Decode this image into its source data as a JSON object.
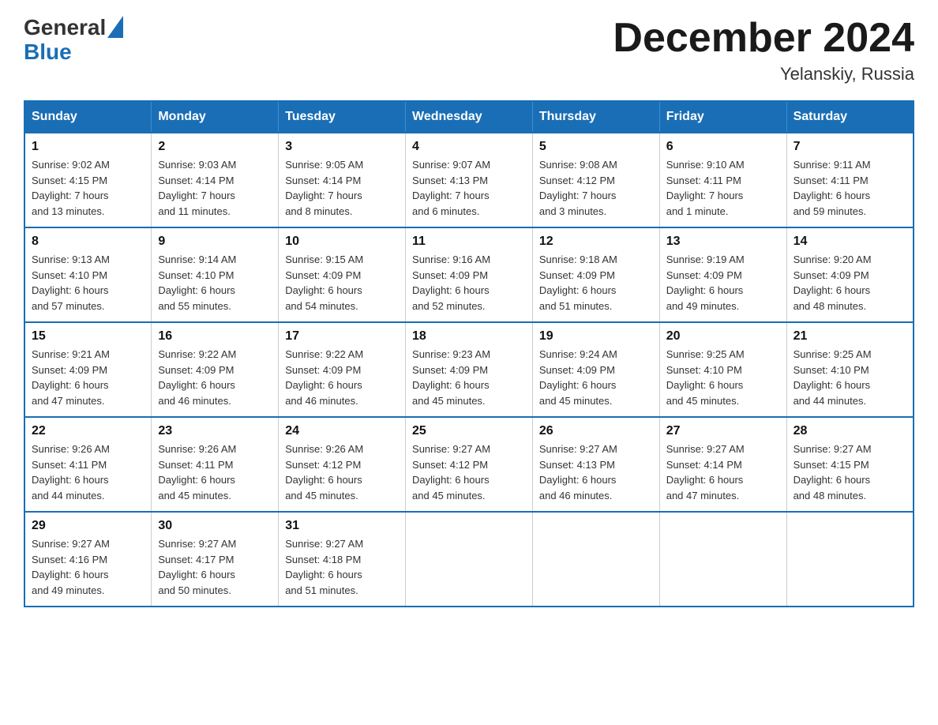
{
  "header": {
    "logo_general": "General",
    "logo_blue": "Blue",
    "month_title": "December 2024",
    "location": "Yelanskiy, Russia"
  },
  "days_of_week": [
    "Sunday",
    "Monday",
    "Tuesday",
    "Wednesday",
    "Thursday",
    "Friday",
    "Saturday"
  ],
  "weeks": [
    [
      {
        "day": "1",
        "info": "Sunrise: 9:02 AM\nSunset: 4:15 PM\nDaylight: 7 hours\nand 13 minutes."
      },
      {
        "day": "2",
        "info": "Sunrise: 9:03 AM\nSunset: 4:14 PM\nDaylight: 7 hours\nand 11 minutes."
      },
      {
        "day": "3",
        "info": "Sunrise: 9:05 AM\nSunset: 4:14 PM\nDaylight: 7 hours\nand 8 minutes."
      },
      {
        "day": "4",
        "info": "Sunrise: 9:07 AM\nSunset: 4:13 PM\nDaylight: 7 hours\nand 6 minutes."
      },
      {
        "day": "5",
        "info": "Sunrise: 9:08 AM\nSunset: 4:12 PM\nDaylight: 7 hours\nand 3 minutes."
      },
      {
        "day": "6",
        "info": "Sunrise: 9:10 AM\nSunset: 4:11 PM\nDaylight: 7 hours\nand 1 minute."
      },
      {
        "day": "7",
        "info": "Sunrise: 9:11 AM\nSunset: 4:11 PM\nDaylight: 6 hours\nand 59 minutes."
      }
    ],
    [
      {
        "day": "8",
        "info": "Sunrise: 9:13 AM\nSunset: 4:10 PM\nDaylight: 6 hours\nand 57 minutes."
      },
      {
        "day": "9",
        "info": "Sunrise: 9:14 AM\nSunset: 4:10 PM\nDaylight: 6 hours\nand 55 minutes."
      },
      {
        "day": "10",
        "info": "Sunrise: 9:15 AM\nSunset: 4:09 PM\nDaylight: 6 hours\nand 54 minutes."
      },
      {
        "day": "11",
        "info": "Sunrise: 9:16 AM\nSunset: 4:09 PM\nDaylight: 6 hours\nand 52 minutes."
      },
      {
        "day": "12",
        "info": "Sunrise: 9:18 AM\nSunset: 4:09 PM\nDaylight: 6 hours\nand 51 minutes."
      },
      {
        "day": "13",
        "info": "Sunrise: 9:19 AM\nSunset: 4:09 PM\nDaylight: 6 hours\nand 49 minutes."
      },
      {
        "day": "14",
        "info": "Sunrise: 9:20 AM\nSunset: 4:09 PM\nDaylight: 6 hours\nand 48 minutes."
      }
    ],
    [
      {
        "day": "15",
        "info": "Sunrise: 9:21 AM\nSunset: 4:09 PM\nDaylight: 6 hours\nand 47 minutes."
      },
      {
        "day": "16",
        "info": "Sunrise: 9:22 AM\nSunset: 4:09 PM\nDaylight: 6 hours\nand 46 minutes."
      },
      {
        "day": "17",
        "info": "Sunrise: 9:22 AM\nSunset: 4:09 PM\nDaylight: 6 hours\nand 46 minutes."
      },
      {
        "day": "18",
        "info": "Sunrise: 9:23 AM\nSunset: 4:09 PM\nDaylight: 6 hours\nand 45 minutes."
      },
      {
        "day": "19",
        "info": "Sunrise: 9:24 AM\nSunset: 4:09 PM\nDaylight: 6 hours\nand 45 minutes."
      },
      {
        "day": "20",
        "info": "Sunrise: 9:25 AM\nSunset: 4:10 PM\nDaylight: 6 hours\nand 45 minutes."
      },
      {
        "day": "21",
        "info": "Sunrise: 9:25 AM\nSunset: 4:10 PM\nDaylight: 6 hours\nand 44 minutes."
      }
    ],
    [
      {
        "day": "22",
        "info": "Sunrise: 9:26 AM\nSunset: 4:11 PM\nDaylight: 6 hours\nand 44 minutes."
      },
      {
        "day": "23",
        "info": "Sunrise: 9:26 AM\nSunset: 4:11 PM\nDaylight: 6 hours\nand 45 minutes."
      },
      {
        "day": "24",
        "info": "Sunrise: 9:26 AM\nSunset: 4:12 PM\nDaylight: 6 hours\nand 45 minutes."
      },
      {
        "day": "25",
        "info": "Sunrise: 9:27 AM\nSunset: 4:12 PM\nDaylight: 6 hours\nand 45 minutes."
      },
      {
        "day": "26",
        "info": "Sunrise: 9:27 AM\nSunset: 4:13 PM\nDaylight: 6 hours\nand 46 minutes."
      },
      {
        "day": "27",
        "info": "Sunrise: 9:27 AM\nSunset: 4:14 PM\nDaylight: 6 hours\nand 47 minutes."
      },
      {
        "day": "28",
        "info": "Sunrise: 9:27 AM\nSunset: 4:15 PM\nDaylight: 6 hours\nand 48 minutes."
      }
    ],
    [
      {
        "day": "29",
        "info": "Sunrise: 9:27 AM\nSunset: 4:16 PM\nDaylight: 6 hours\nand 49 minutes."
      },
      {
        "day": "30",
        "info": "Sunrise: 9:27 AM\nSunset: 4:17 PM\nDaylight: 6 hours\nand 50 minutes."
      },
      {
        "day": "31",
        "info": "Sunrise: 9:27 AM\nSunset: 4:18 PM\nDaylight: 6 hours\nand 51 minutes."
      },
      {
        "day": "",
        "info": ""
      },
      {
        "day": "",
        "info": ""
      },
      {
        "day": "",
        "info": ""
      },
      {
        "day": "",
        "info": ""
      }
    ]
  ]
}
